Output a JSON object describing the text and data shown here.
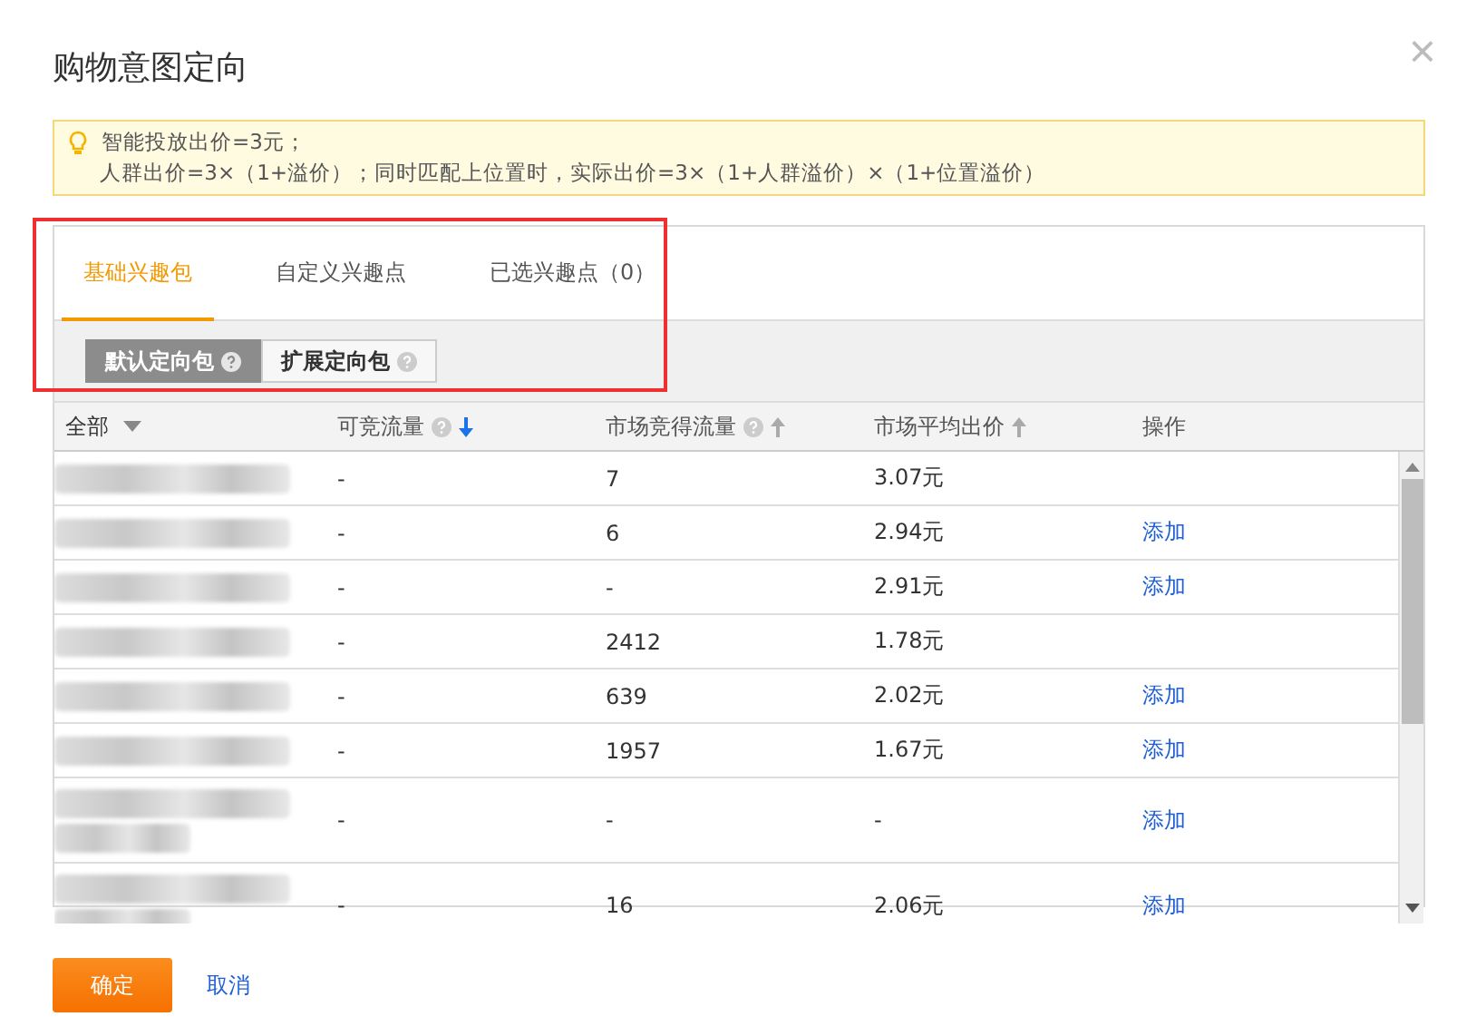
{
  "dialog": {
    "title": "购物意图定向",
    "close": "×"
  },
  "notice": {
    "lines": [
      "智能投放出价=3元；",
      "人群出价=3×（1+溢价）；同时匹配上位置时，实际出价=3×（1+人群溢价）×（1+位置溢价）"
    ]
  },
  "tabs": [
    {
      "label": "基础兴趣包",
      "selected": true
    },
    {
      "label": "自定义兴趣点",
      "selected": false
    },
    {
      "label": "已选兴趣点（0）",
      "selected": false
    }
  ],
  "sub_tabs": [
    {
      "label": "默认定向包",
      "selected": true
    },
    {
      "label": "扩展定向包",
      "selected": false
    }
  ],
  "table": {
    "columns": [
      {
        "label": "全部",
        "kind": "filter",
        "help": false,
        "sorted": false
      },
      {
        "label": "可竞流量",
        "kind": "sortable",
        "help": true,
        "sorted": true
      },
      {
        "label": "市场竞得流量",
        "kind": "sortable",
        "help": true,
        "sorted": false
      },
      {
        "label": "市场平均出价",
        "kind": "sortable",
        "help": false,
        "sorted": false
      },
      {
        "label": "操作",
        "kind": "plain",
        "help": false,
        "sorted": false
      }
    ],
    "rows": [
      {
        "kind": "short",
        "traffic": "-",
        "won": "7",
        "avg_bid": "3.07元",
        "action": ""
      },
      {
        "kind": "short",
        "traffic": "-",
        "won": "6",
        "avg_bid": "2.94元",
        "action": "添加"
      },
      {
        "kind": "short",
        "traffic": "-",
        "won": "-",
        "avg_bid": "2.91元",
        "action": "添加"
      },
      {
        "kind": "short",
        "traffic": "-",
        "won": "2412",
        "avg_bid": "1.78元",
        "action": ""
      },
      {
        "kind": "short",
        "traffic": "-",
        "won": "639",
        "avg_bid": "2.02元",
        "action": "添加"
      },
      {
        "kind": "short",
        "traffic": "-",
        "won": "1957",
        "avg_bid": "1.67元",
        "action": "添加"
      },
      {
        "kind": "tall",
        "traffic": "-",
        "won": "-",
        "avg_bid": "-",
        "action": "添加"
      },
      {
        "kind": "tall",
        "traffic": "-",
        "won": "16",
        "avg_bid": "2.06元",
        "action": "添加"
      }
    ]
  },
  "buttons": {
    "confirm": "确定",
    "cancel": "取消"
  }
}
